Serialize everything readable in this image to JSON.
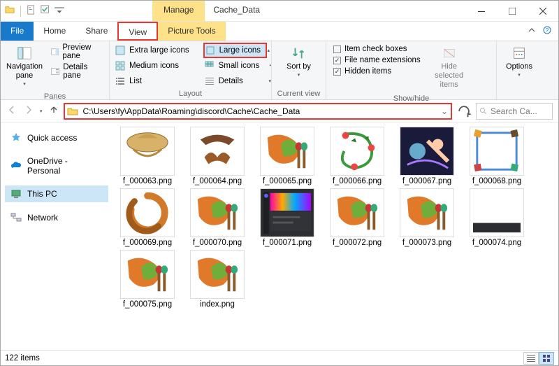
{
  "window": {
    "contextual_tab": "Manage",
    "title": "Cache_Data"
  },
  "tabs": {
    "file": "File",
    "home": "Home",
    "share": "Share",
    "view": "View",
    "picture_tools": "Picture Tools"
  },
  "ribbon": {
    "panes": {
      "nav_pane": "Navigation pane",
      "preview": "Preview pane",
      "details": "Details pane",
      "group_label": "Panes"
    },
    "layout": {
      "extra_large": "Extra large icons",
      "large": "Large icons",
      "medium": "Medium icons",
      "small": "Small icons",
      "list": "List",
      "details": "Details",
      "group_label": "Layout"
    },
    "current_view": {
      "sort_by": "Sort by",
      "group_label": "Current view"
    },
    "show_hide": {
      "item_checkboxes": "Item check boxes",
      "file_ext": "File name extensions",
      "hidden": "Hidden items",
      "hide_selected": "Hide selected items",
      "group_label": "Show/hide"
    },
    "options": "Options"
  },
  "address": {
    "path": "C:\\Users\\fy\\AppData\\Roaming\\discord\\Cache\\Cache_Data"
  },
  "search": {
    "placeholder": "Search Ca..."
  },
  "sidebar": {
    "quick_access": "Quick access",
    "onedrive": "OneDrive - Personal",
    "this_pc": "This PC",
    "network": "Network"
  },
  "files": [
    {
      "name": "f_000063.png",
      "thumb": "hat1"
    },
    {
      "name": "f_000064.png",
      "thumb": "hat2"
    },
    {
      "name": "f_000065.png",
      "thumb": "paint"
    },
    {
      "name": "f_000066.png",
      "thumb": "vine"
    },
    {
      "name": "f_000067.png",
      "thumb": "fantasy"
    },
    {
      "name": "f_000068.png",
      "thumb": "frame"
    },
    {
      "name": "f_000069.png",
      "thumb": "ring"
    },
    {
      "name": "f_000070.png",
      "thumb": "paint"
    },
    {
      "name": "f_000071.png",
      "thumb": "discord"
    },
    {
      "name": "f_000072.png",
      "thumb": "paint"
    },
    {
      "name": "f_000073.png",
      "thumb": "paint"
    },
    {
      "name": "f_000074.png",
      "thumb": "bar"
    },
    {
      "name": "f_000075.png",
      "thumb": "paint"
    },
    {
      "name": "index.png",
      "thumb": "paint"
    }
  ],
  "status": {
    "count": "122 items"
  }
}
